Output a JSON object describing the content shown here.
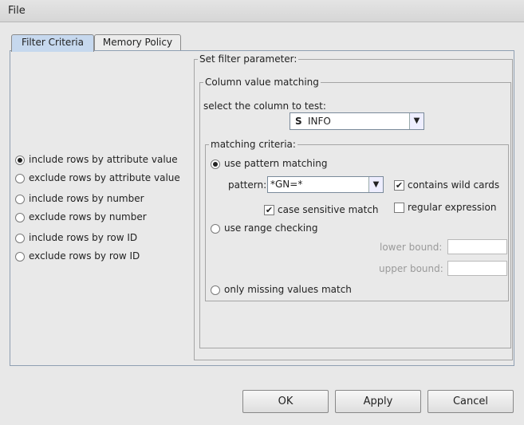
{
  "menu": {
    "file": "File"
  },
  "tabs": [
    {
      "label": "Filter Criteria"
    },
    {
      "label": "Memory Policy"
    }
  ],
  "left_options": [
    {
      "label": "include rows by attribute value",
      "selected": true
    },
    {
      "label": "exclude rows by attribute value",
      "selected": false
    },
    {
      "label": "include rows by number",
      "selected": false
    },
    {
      "label": "exclude rows by number",
      "selected": false
    },
    {
      "label": "include rows by row ID",
      "selected": false
    },
    {
      "label": "exclude rows by row ID",
      "selected": false
    }
  ],
  "filter": {
    "title": "Set filter parameter:",
    "column_group": "Column value matching",
    "select_label": "select the column to test:",
    "column_type_icon": "S",
    "column_value": "INFO",
    "criteria_title": "matching criteria:",
    "use_pattern": "use pattern matching",
    "pattern_label": "pattern:",
    "pattern_value": "*GN=*",
    "contains_wild": "contains wild cards",
    "contains_wild_checked": true,
    "case_sensitive": "case sensitive match",
    "case_sensitive_checked": true,
    "regex": "regular expression",
    "regex_checked": false,
    "use_range": "use range checking",
    "lower_bound": "lower bound:",
    "upper_bound": "upper bound:",
    "missing": "only missing values match"
  },
  "buttons": {
    "ok": "OK",
    "apply": "Apply",
    "cancel": "Cancel"
  }
}
